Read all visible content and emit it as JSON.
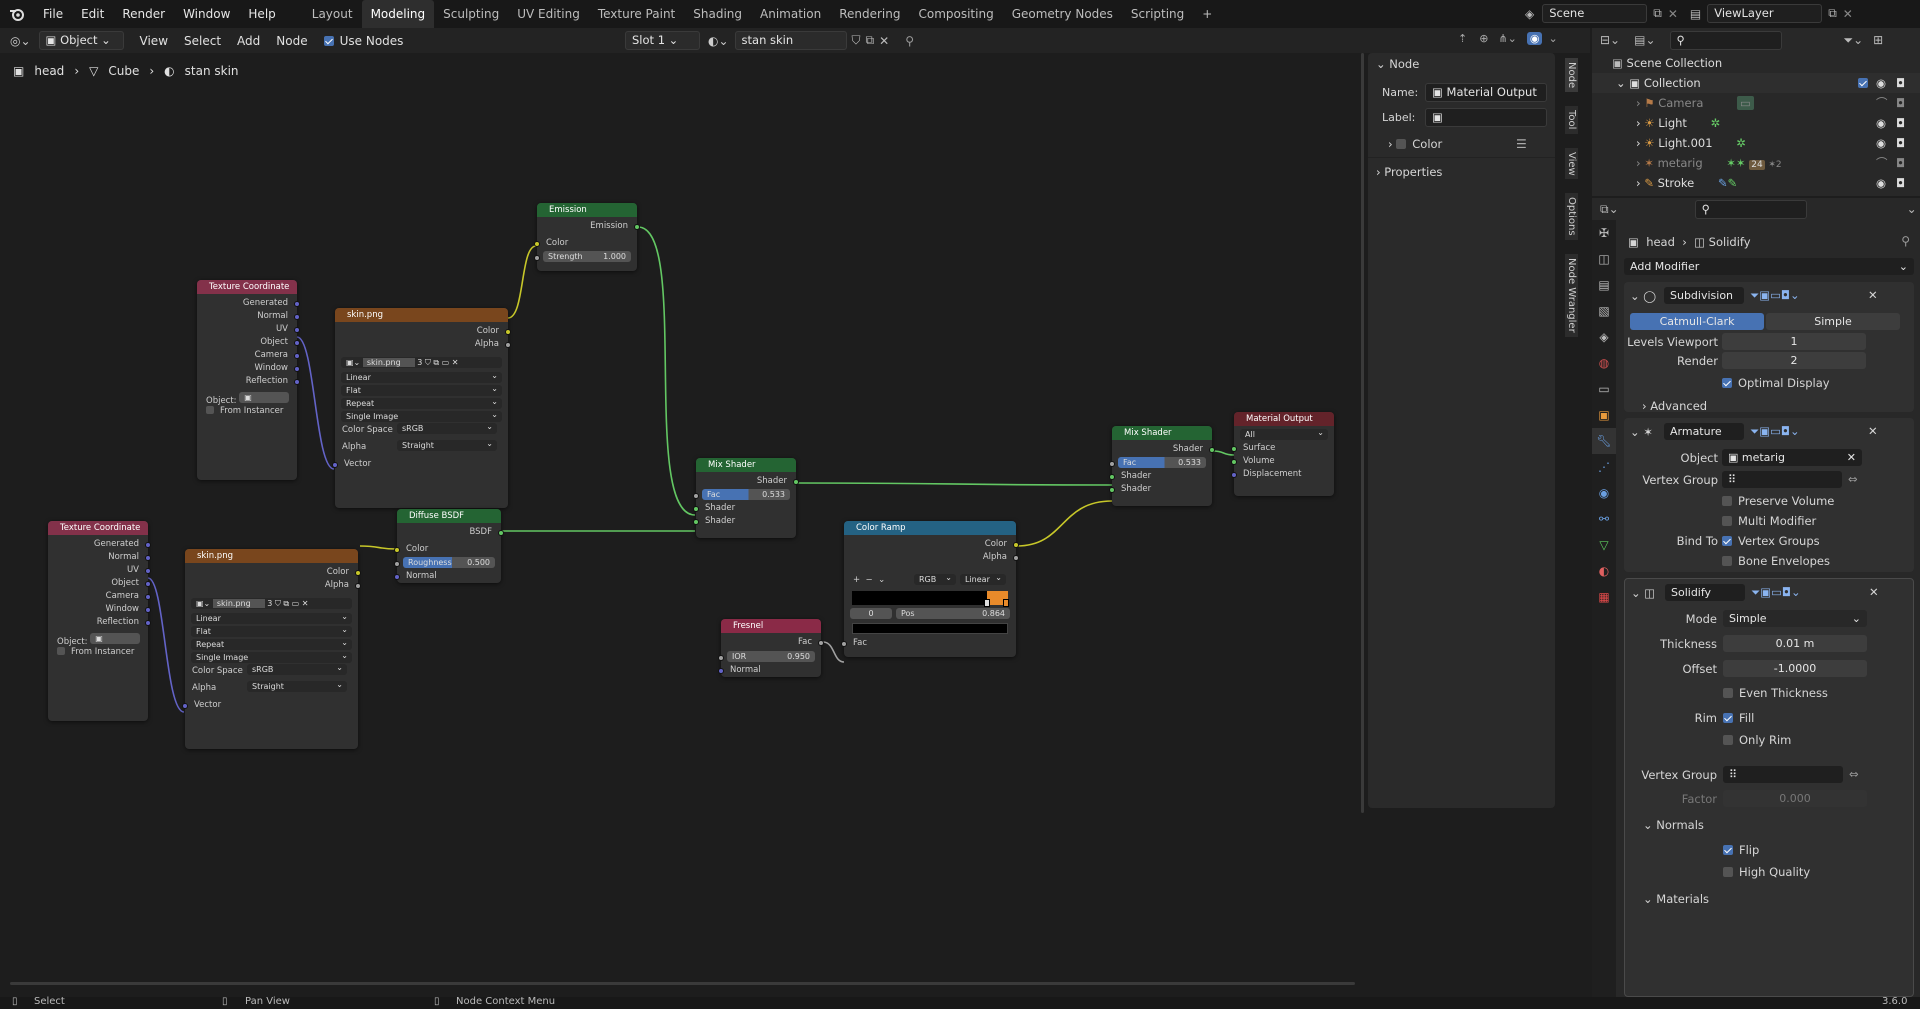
{
  "topbar": {
    "menus": [
      "File",
      "Edit",
      "Render",
      "Window",
      "Help"
    ],
    "workspaces": [
      "Layout",
      "Modeling",
      "Sculpting",
      "UV Editing",
      "Texture Paint",
      "Shading",
      "Animation",
      "Rendering",
      "Compositing",
      "Geometry Nodes",
      "Scripting"
    ],
    "active_workspace": "Modeling",
    "add_symbol": "+",
    "scene": "Scene",
    "view_layer": "ViewLayer"
  },
  "header": {
    "mode": "Object",
    "view": "View",
    "select": "Select",
    "add": "Add",
    "node": "Node",
    "use_nodes": "Use Nodes",
    "slot": "Slot 1",
    "material": "stan skin"
  },
  "breadcrumb": {
    "object": "head",
    "mesh": "Cube",
    "material": "stan skin"
  },
  "nodes": {
    "tc1": {
      "title": "Texture Coordinate",
      "outputs": [
        "Generated",
        "Normal",
        "UV",
        "Object",
        "Camera",
        "Window",
        "Reflection"
      ],
      "object_label": "Object:",
      "instancer": "From Instancer"
    },
    "tc2": {
      "title": "Texture Coordinate",
      "outputs": [
        "Generated",
        "Normal",
        "UV",
        "Object",
        "Camera",
        "Window",
        "Reflection"
      ],
      "object_label": "Object:",
      "instancer": "From Instancer"
    },
    "img1": {
      "title": "skin.png",
      "color": "Color",
      "alpha": "Alpha",
      "file": "skin.png",
      "users": "3",
      "interp": "Linear",
      "proj": "Flat",
      "ext": "Repeat",
      "source": "Single Image",
      "cs_label": "Color Space",
      "cs": "sRGB",
      "alpha_label": "Alpha",
      "alpha_mode": "Straight",
      "vector": "Vector"
    },
    "img2": {
      "title": "skin.png",
      "color": "Color",
      "alpha": "Alpha",
      "file": "skin.png",
      "users": "3",
      "interp": "Linear",
      "proj": "Flat",
      "ext": "Repeat",
      "source": "Single Image",
      "cs_label": "Color Space",
      "cs": "sRGB",
      "alpha_label": "Alpha",
      "alpha_mode": "Straight",
      "vector": "Vector"
    },
    "emission": {
      "title": "Emission",
      "out": "Emission",
      "color": "Color",
      "strength_label": "Strength",
      "strength": "1.000"
    },
    "diffuse": {
      "title": "Diffuse BSDF",
      "out": "BSDF",
      "color": "Color",
      "rough_label": "Roughness",
      "rough": "0.500",
      "normal": "Normal"
    },
    "mix1": {
      "title": "Mix Shader",
      "out": "Shader",
      "fac_label": "Fac",
      "fac": "0.533",
      "in1": "Shader",
      "in2": "Shader"
    },
    "mix2": {
      "title": "Mix Shader",
      "out": "Shader",
      "fac_label": "Fac",
      "fac": "0.533",
      "in1": "Shader",
      "in2": "Shader"
    },
    "output": {
      "title": "Material Output",
      "target": "All",
      "surface": "Surface",
      "volume": "Volume",
      "displacement": "Displacement"
    },
    "ramp": {
      "title": "Color Ramp",
      "color": "Color",
      "alpha": "Alpha",
      "mode": "RGB",
      "interp": "Linear",
      "index": "0",
      "pos_label": "Pos",
      "pos": "0.864",
      "fac": "Fac",
      "ramp_fraction": 0.864
    },
    "fresnel": {
      "title": "Fresnel",
      "out": "Fac",
      "ior_label": "IOR",
      "ior": "0.950",
      "normal": "Normal"
    }
  },
  "sidebar": {
    "panel": "Node",
    "name_label": "Name:",
    "name": "Material Output",
    "label_label": "Label:",
    "color": "Color",
    "properties": "Properties"
  },
  "vtabs": [
    "Node",
    "Tool",
    "View",
    "Options",
    "Node Wrangler"
  ],
  "outliner": {
    "root": "Scene Collection",
    "collection": "Collection",
    "items": [
      {
        "name": "Camera",
        "visible": false
      },
      {
        "name": "Light",
        "visible": true
      },
      {
        "name": "Light.001",
        "visible": true
      },
      {
        "name": "metarig",
        "visible": false
      },
      {
        "name": "Stroke",
        "visible": true
      }
    ],
    "metarig_badge": "24",
    "metarig_count": "2"
  },
  "properties": {
    "object": "head",
    "modifier": "Solidify",
    "add_modifier": "Add Modifier",
    "subdivision": {
      "name": "Subdivision",
      "catmull": "Catmull-Clark",
      "simple": "Simple",
      "levels_label": "Levels Viewport",
      "levels": "1",
      "render_label": "Render",
      "render": "2",
      "optimal": "Optimal Display",
      "advanced": "Advanced"
    },
    "armature": {
      "name": "Armature",
      "object_label": "Object",
      "object": "metarig",
      "vgroup_label": "Vertex Group",
      "preserve": "Preserve Volume",
      "multi": "Multi Modifier",
      "bindto_label": "Bind To",
      "vgroups": "Vertex Groups",
      "envelopes": "Bone Envelopes"
    },
    "solidify": {
      "name": "Solidify",
      "mode_label": "Mode",
      "mode": "Simple",
      "thick_label": "Thickness",
      "thick": "0.01 m",
      "offset_label": "Offset",
      "offset": "-1.0000",
      "even": "Even Thickness",
      "rim_label": "Rim",
      "fill": "Fill",
      "onlyrim": "Only Rim",
      "vgroup_label": "Vertex Group",
      "factor_label": "Factor",
      "factor": "0.000",
      "normals": "Normals",
      "flip": "Flip",
      "hq": "High Quality",
      "materials": "Materials"
    }
  },
  "status": {
    "select": "Select",
    "pan": "Pan View",
    "context": "Node Context Menu",
    "version": "3.6.0"
  }
}
